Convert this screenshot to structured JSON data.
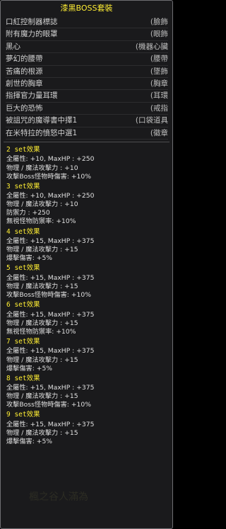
{
  "title": "漆黑BOSS套裝",
  "items": [
    {
      "name": "口紅控制器標誌",
      "category": "(臉飾"
    },
    {
      "name": "附有魔力的眼罩",
      "category": "(眼飾"
    },
    {
      "name": "黑心",
      "category": "(機器心臟"
    },
    {
      "name": "夢幻的腰帶",
      "category": "(腰帶"
    },
    {
      "name": "苦痛的根源",
      "category": "(墜飾"
    },
    {
      "name": "創世的胸章",
      "category": "(胸章"
    },
    {
      "name": "指揮官力量耳環",
      "category": "(耳環"
    },
    {
      "name": "巨大的恐怖",
      "category": "(戒指"
    },
    {
      "name": "被詛咒的魔導書中擇1",
      "category": "(口袋道具"
    },
    {
      "name": "在米特拉的憤怒中選1",
      "category": "(徽章"
    }
  ],
  "sets": [
    {
      "label": "2 set效果",
      "stats": [
        "全屬性: +10, MaxHP : +250",
        "物理 / 魔法攻擊力 : +10",
        "攻擊Boss怪物時傷害: +10%"
      ]
    },
    {
      "label": "3 set效果",
      "stats": [
        "全屬性: +10, MaxHP : +250",
        "物理 / 魔法攻擊力 : +10",
        "防禦力 : +250",
        "無視怪物防禦率: +10%"
      ]
    },
    {
      "label": "4 set效果",
      "stats": [
        "全屬性: +15, MaxHP : +375",
        "物理 / 魔法攻擊力 : +15",
        "爆擊傷害: +5%"
      ]
    },
    {
      "label": "5 set效果",
      "stats": [
        "全屬性: +15, MaxHP : +375",
        "物理 / 魔法攻擊力 : +15",
        "攻擊Boss怪物時傷害: +10%"
      ]
    },
    {
      "label": "6 set效果",
      "stats": [
        "全屬性: +15, MaxHP : +375",
        "物理 / 魔法攻擊力 : +15",
        "無視怪物防禦率: +10%"
      ]
    },
    {
      "label": "7 set效果",
      "stats": [
        "全屬性: +15, MaxHP : +375",
        "物理 / 魔法攻擊力 : +15",
        "爆擊傷害: +5%"
      ]
    },
    {
      "label": "8 set效果",
      "stats": [
        "全屬性: +15, MaxHP : +375",
        "物理 / 魔法攻擊力 : +15",
        "攻擊Boss怪物時傷害: +10%"
      ]
    },
    {
      "label": "9 set效果",
      "stats": [
        "全屬性: +15, MaxHP : +375",
        "物理 / 魔法攻擊力 : +15",
        "爆擊傷害: +5%"
      ]
    }
  ],
  "watermark": "楓之谷人滿為",
  "colors": {
    "title": "#ffee33",
    "set_header": "#ffee33",
    "text": "#e0e0e0",
    "background": "#1a1a1c"
  }
}
